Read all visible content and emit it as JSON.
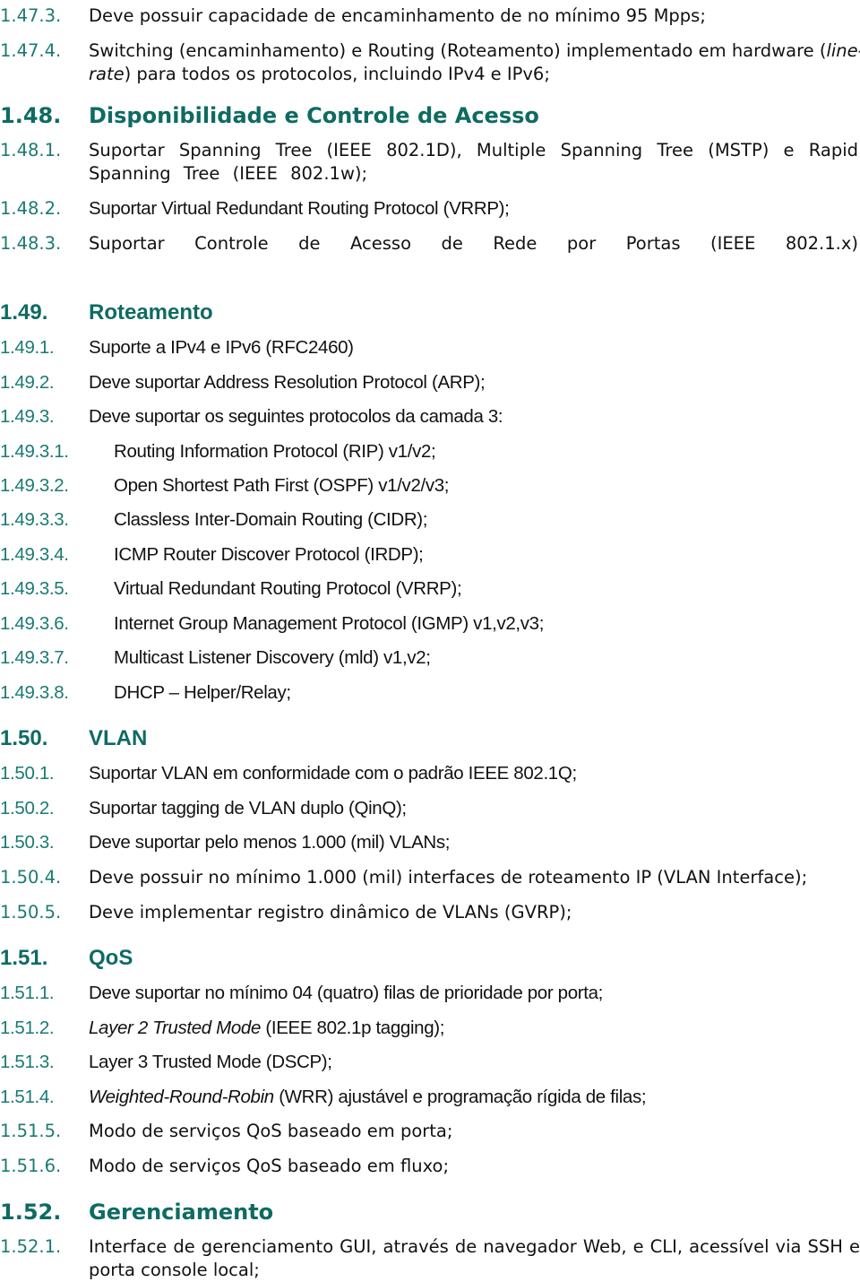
{
  "document": {
    "accent_color": "#0e6b63",
    "number_color": "#1a7a72",
    "items": [
      {
        "num": "1.47.3.",
        "text": "Deve possuir capacidade de encaminhamento de no mínimo 95 Mpps;"
      },
      {
        "num": "1.47.4.",
        "text_line1_a": "Switching (encaminhamento) e Routing (Roteamento) implementado em hardware (",
        "text_line1_italic": "line-",
        "text_line2_italic": "rate",
        "text_line2_b": ") para todos os protocolos, incluindo IPv4 e IPv6;"
      },
      {
        "num": "1.48.",
        "text": "Disponibilidade e Controle de Acesso",
        "type": "heading"
      },
      {
        "num": "1.48.1.",
        "text": "Suportar Spanning Tree (IEEE 802.1D), Multiple Spanning Tree (MSTP) e Rapid Spanning Tree (IEEE 802.1w);"
      },
      {
        "num": "1.48.2.",
        "text": "Suportar Virtual Redundant Routing Protocol (VRRP);"
      },
      {
        "num": "1.48.3.",
        "text": "Suportar Controle de Acesso de Rede por Portas (IEEE 802.1.x)"
      },
      {
        "num": "1.49.",
        "text": "Roteamento",
        "type": "heading"
      },
      {
        "num": "1.49.1.",
        "text": "Suporte a IPv4 e IPv6 (RFC2460)"
      },
      {
        "num": "1.49.2.",
        "text": "Deve suportar Address Resolution Protocol (ARP);"
      },
      {
        "num": "1.49.3.",
        "text": "Deve suportar os seguintes protocolos da camada 3:"
      },
      {
        "num": "1.49.3.1.",
        "text": "Routing Information Protocol (RIP) v1/v2;"
      },
      {
        "num": "1.49.3.2.",
        "text": "Open Shortest Path First (OSPF) v1/v2/v3;"
      },
      {
        "num": "1.49.3.3.",
        "text": "Classless Inter-Domain Routing (CIDR);"
      },
      {
        "num": "1.49.3.4.",
        "text": "ICMP Router Discover Protocol (IRDP);"
      },
      {
        "num": "1.49.3.5.",
        "text": "Virtual Redundant Routing Protocol (VRRP);"
      },
      {
        "num": "1.49.3.6.",
        "text": "Internet Group Management Protocol (IGMP) v1,v2,v3;"
      },
      {
        "num": "1.49.3.7.",
        "text": "Multicast Listener Discovery (mld) v1,v2;"
      },
      {
        "num": "1.49.3.8.",
        "text": "DHCP – Helper/Relay;"
      },
      {
        "num": "1.50.",
        "text": "VLAN",
        "type": "heading"
      },
      {
        "num": "1.50.1.",
        "text": "Suportar VLAN em conformidade com o padrão IEEE 802.1Q;"
      },
      {
        "num": "1.50.2.",
        "text": "Suportar tagging de VLAN duplo (QinQ);"
      },
      {
        "num": "1.50.3.",
        "text": "Deve suportar pelo menos 1.000 (mil) VLANs;"
      },
      {
        "num": "1.50.4.",
        "text": "Deve possuir no mínimo 1.000 (mil) interfaces de roteamento IP (VLAN Interface);"
      },
      {
        "num": "1.50.5.",
        "text": "Deve implementar registro dinâmico de VLANs (GVRP);"
      },
      {
        "num": "1.51.",
        "text": "QoS",
        "type": "heading"
      },
      {
        "num": "1.51.1.",
        "text": "Deve suportar no mínimo 04 (quatro) filas de prioridade por porta;"
      },
      {
        "num": "1.51.2.",
        "text_italic": "Layer 2 Trusted Mode",
        "text_rest": " (IEEE 802.1p tagging);"
      },
      {
        "num": "1.51.3.",
        "text": "Layer 3 Trusted Mode (DSCP);"
      },
      {
        "num": "1.51.4.",
        "text_italic": "Weighted-Round-Robin",
        "text_rest": " (WRR) ajustável e programação rígida de filas;"
      },
      {
        "num": "1.51.5.",
        "text": "Modo de serviços QoS baseado em porta;"
      },
      {
        "num": "1.51.6.",
        "text": "Modo de serviços QoS baseado em fluxo;"
      },
      {
        "num": "1.52.",
        "text": "Gerenciamento",
        "type": "heading"
      },
      {
        "num": "1.52.1.",
        "text": "Interface de gerenciamento GUI, através de navegador Web, e CLI, acessível via SSH e porta console local;"
      }
    ]
  }
}
